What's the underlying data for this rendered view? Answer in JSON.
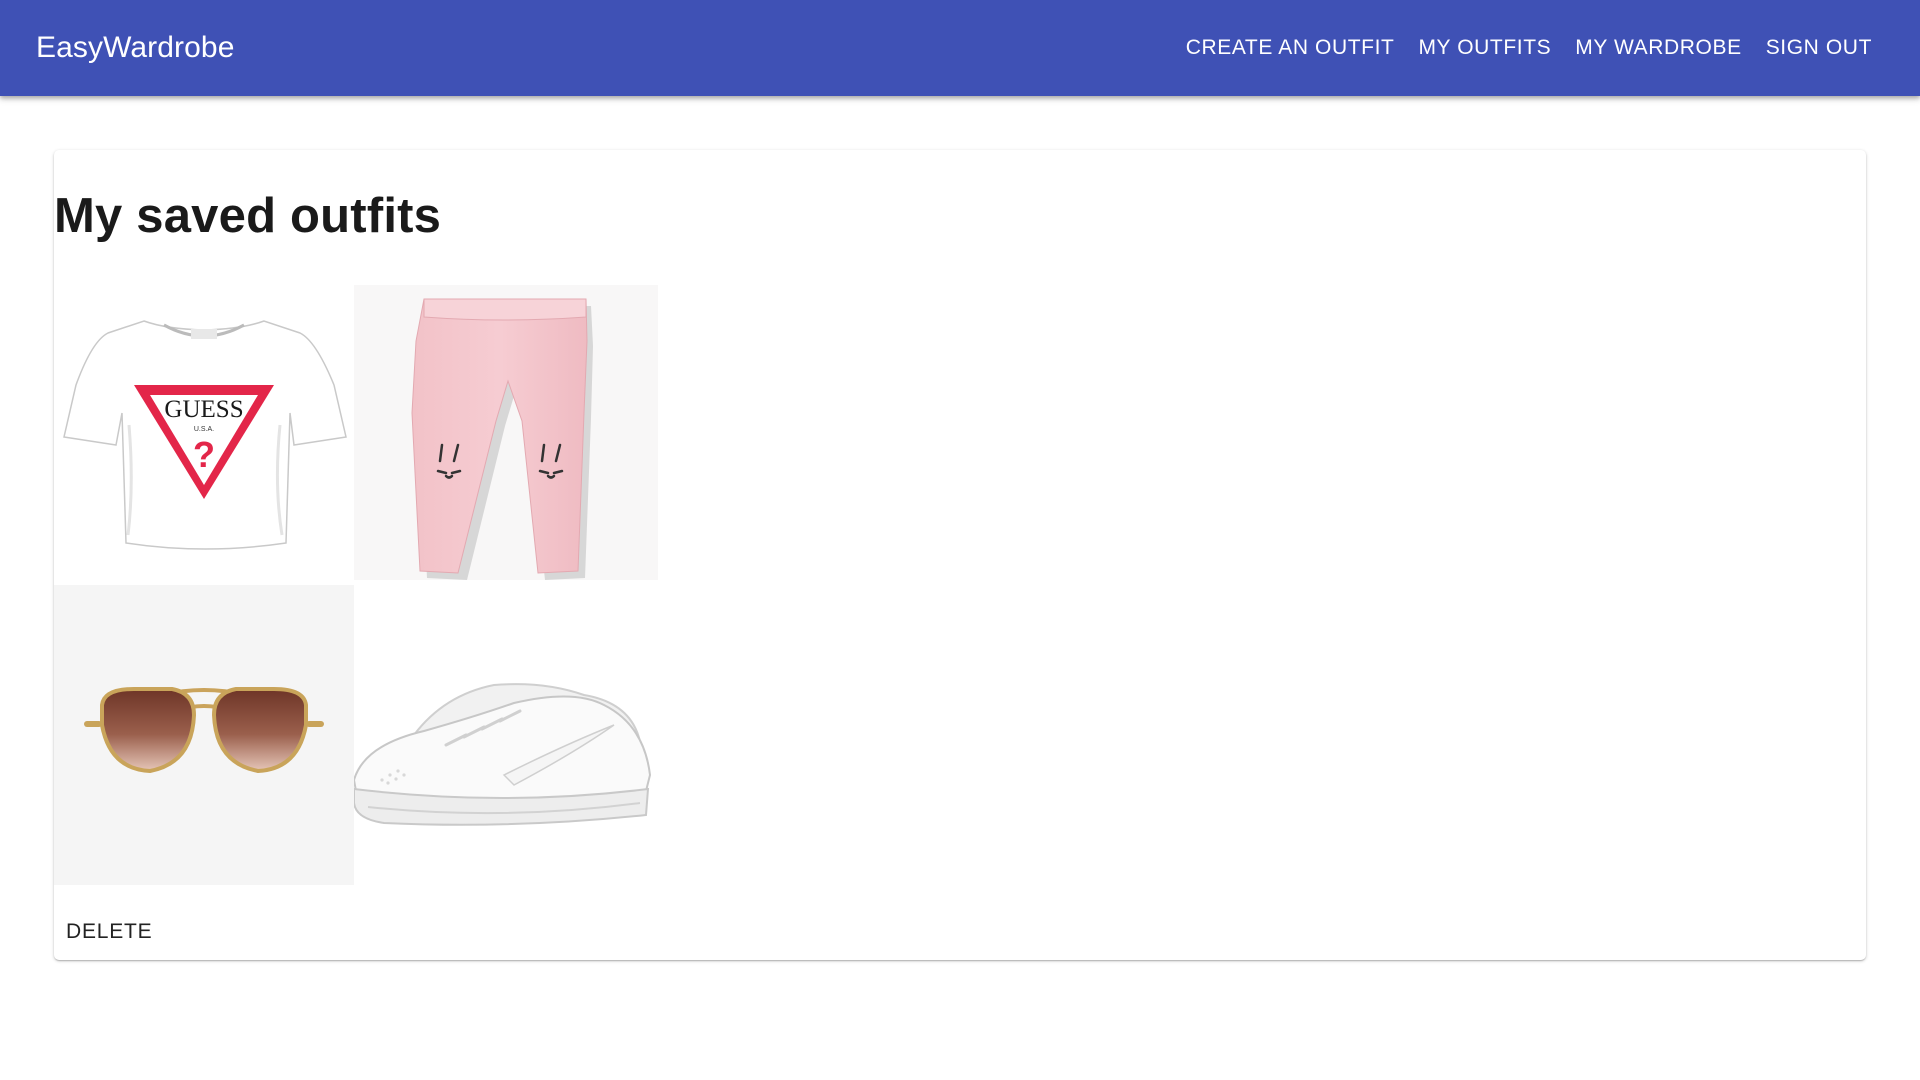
{
  "app": {
    "brand": "EasyWardrobe",
    "accent_color": "#3f51b5"
  },
  "nav": {
    "items": [
      {
        "label": "CREATE AN OUTFIT"
      },
      {
        "label": "MY OUTFITS"
      },
      {
        "label": "MY WARDROBE"
      },
      {
        "label": "SIGN OUT"
      }
    ]
  },
  "main": {
    "title": "My saved outfits",
    "outfit": {
      "items": [
        {
          "icon": "tshirt-image",
          "logo_text": "GUESS",
          "sub_text": "U.S.A."
        },
        {
          "icon": "pink-leggings-image"
        },
        {
          "icon": "sunglasses-image"
        },
        {
          "icon": "white-sneakers-image"
        }
      ],
      "delete_label": "DELETE"
    }
  }
}
